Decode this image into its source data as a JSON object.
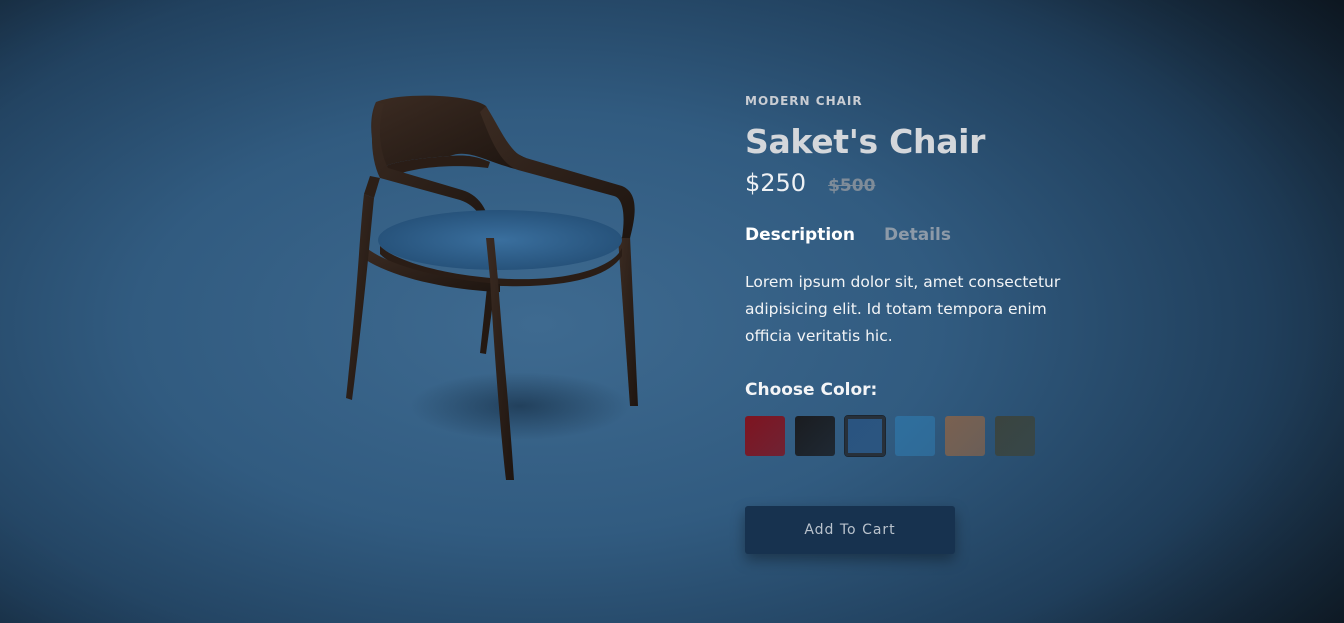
{
  "product": {
    "category": "MODERN CHAIR",
    "name": "Saket's Chair",
    "price": "$250",
    "old_price": "$500"
  },
  "tabs": [
    {
      "label": "Description",
      "active": true
    },
    {
      "label": "Details",
      "active": false
    }
  ],
  "description": "Lorem ipsum dolor sit, amet consectetur adipisicing elit. Id totam tempora enim officia veritatis hic.",
  "color_picker": {
    "label": "Choose Color:",
    "options": [
      {
        "name": "red",
        "color": "#7e1420",
        "selected": false
      },
      {
        "name": "black",
        "color": "#1a1c20",
        "selected": false
      },
      {
        "name": "navy-blue",
        "color": "#2a5480",
        "selected": true
      },
      {
        "name": "light-blue",
        "color": "#2f6f9e",
        "selected": false
      },
      {
        "name": "brown",
        "color": "#7a6150",
        "selected": false
      },
      {
        "name": "dark-green",
        "color": "#3a443f",
        "selected": false
      }
    ]
  },
  "cart_button": {
    "label": "Add To Cart"
  }
}
